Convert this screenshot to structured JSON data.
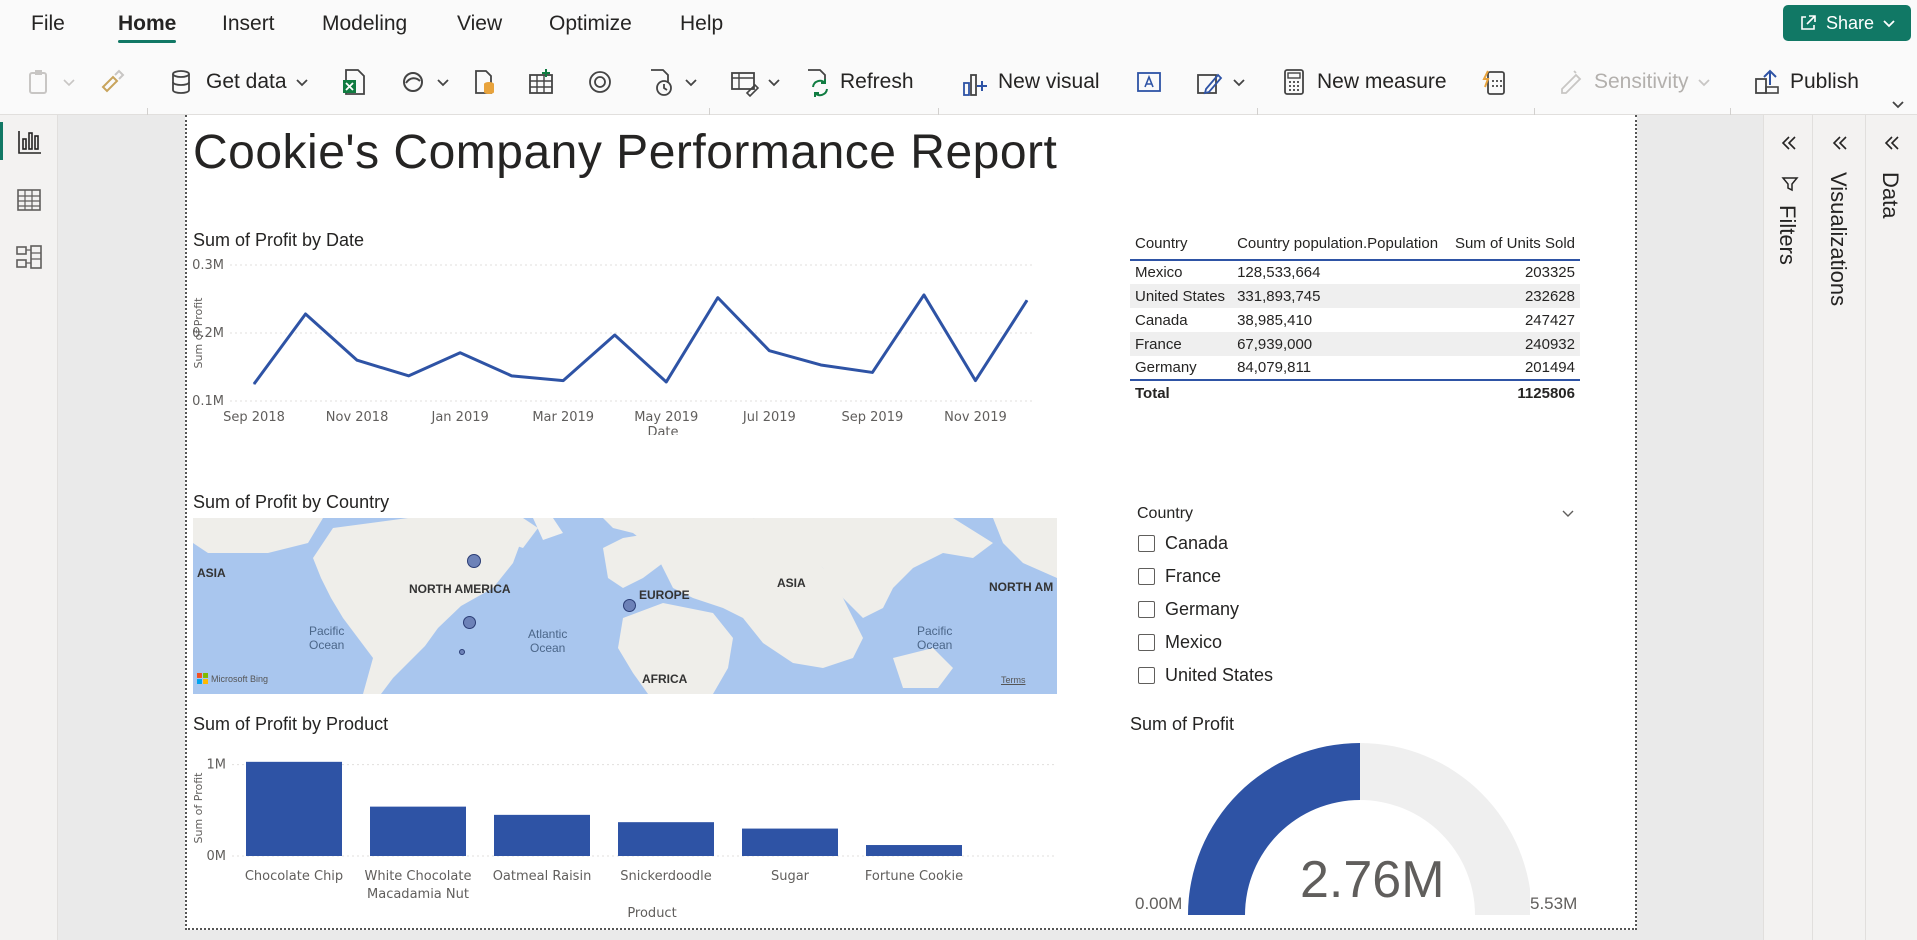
{
  "menu": {
    "items": [
      "File",
      "Home",
      "Insert",
      "Modeling",
      "View",
      "Optimize",
      "Help"
    ],
    "share_label": "Share"
  },
  "ribbon": {
    "get_data": "Get data",
    "refresh": "Refresh",
    "new_visual": "New visual",
    "new_measure": "New measure",
    "sensitivity": "Sensitivity",
    "publish": "Publish"
  },
  "report": {
    "title": "Cookie's Company Performance Report"
  },
  "line_chart": {
    "title": "Sum of Profit by Date",
    "chart_data": {
      "type": "line",
      "xlabel": "Date",
      "ylabel": "Sum of Profit",
      "x_ticks": [
        "Sep 2018",
        "Nov 2018",
        "Jan 2019",
        "Mar 2019",
        "May 2019",
        "Jul 2019",
        "Sep 2019",
        "Nov 2019"
      ],
      "y_ticks": [
        "0.3M",
        "0.2M",
        "0.1M"
      ],
      "ylim": [
        0.1,
        0.3
      ],
      "x": [
        "Sep 2018",
        "Oct 2018",
        "Nov 2018",
        "Dec 2018",
        "Jan 2019",
        "Feb 2019",
        "Mar 2019",
        "Apr 2019",
        "May 2019",
        "Jun 2019",
        "Jul 2019",
        "Aug 2019",
        "Sep 2019",
        "Oct 2019",
        "Nov 2019",
        "Dec 2019"
      ],
      "values": [
        0.125,
        0.228,
        0.16,
        0.137,
        0.171,
        0.137,
        0.13,
        0.197,
        0.128,
        0.252,
        0.174,
        0.153,
        0.142,
        0.256,
        0.13,
        0.248
      ],
      "grid": true
    }
  },
  "table": {
    "headers": [
      "Country",
      "Country population.Population",
      "Sum of Units Sold"
    ],
    "rows": [
      [
        "Mexico",
        "128,533,664",
        "203325"
      ],
      [
        "United States",
        "331,893,745",
        "232628"
      ],
      [
        "Canada",
        "38,985,410",
        "247427"
      ],
      [
        "France",
        "67,939,000",
        "240932"
      ],
      [
        "Germany",
        "84,079,811",
        "201494"
      ]
    ],
    "total_label": "Total",
    "total_value": "1125806"
  },
  "map": {
    "title": "Sum of Profit by Country",
    "labels": {
      "asia_left": "ASIA",
      "north_america": "NORTH AMERICA",
      "europe": "EUROPE",
      "asia_right": "ASIA",
      "north_america_right": "NORTH AM",
      "pacific_left": "Pacific\nOcean",
      "atlantic": "Atlantic\nOcean",
      "pacific_right": "Pacific\nOcean",
      "africa": "AFRICA",
      "bing": "Microsoft Bing",
      "terms": "Terms"
    }
  },
  "slicer": {
    "title": "Country",
    "options": [
      "Canada",
      "France",
      "Germany",
      "Mexico",
      "United States"
    ]
  },
  "bar_chart": {
    "title": "Sum of Profit by Product",
    "chart_data": {
      "type": "bar",
      "xlabel": "Product",
      "ylabel": "Sum of Profit",
      "categories": [
        "Chocolate Chip",
        "White Chocolate\nMacadamia Nut",
        "Oatmeal Raisin",
        "Snickerdoodle",
        "Sugar",
        "Fortune Cookie"
      ],
      "values": [
        1.03,
        0.54,
        0.45,
        0.37,
        0.3,
        0.12
      ],
      "y_ticks": [
        "1M",
        "0M"
      ],
      "ylim": [
        0,
        1.05
      ],
      "grid": true
    }
  },
  "gauge": {
    "title": "Sum of Profit",
    "value": "2.76M",
    "min": "0.00M",
    "max": "5.53M",
    "fraction": 0.5
  },
  "panes": {
    "filters": "Filters",
    "visualizations": "Visualizations",
    "data": "Data"
  },
  "colors": {
    "accent": "#117865",
    "series": "#2e53a5",
    "gauge_track": "#efefef"
  }
}
